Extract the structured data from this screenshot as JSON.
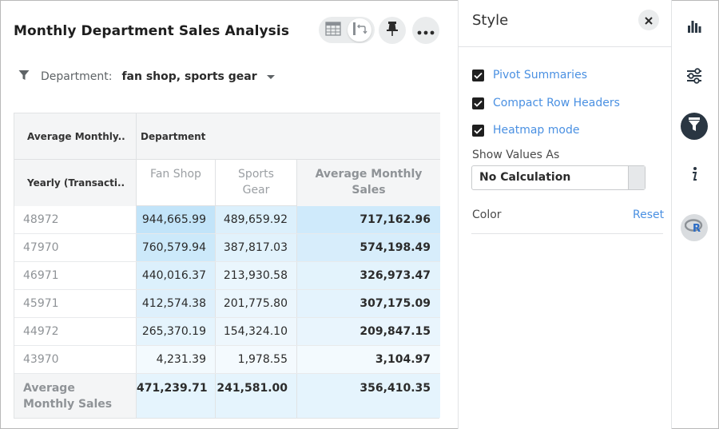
{
  "header": {
    "title": "Monthly Department Sales Analysis"
  },
  "filter": {
    "label": "Department:",
    "value": "fan shop, sports gear"
  },
  "table": {
    "corner_header": "Average Monthly..",
    "column_group_header": "Department",
    "row_header": "Yearly (Transacti..",
    "columns": [
      "Fan Shop",
      "Sports Gear",
      "Average Monthly Sales"
    ],
    "rows": [
      {
        "key": "48972",
        "fan_shop": "944,665.99",
        "sports_gear": "489,659.92",
        "average": "717,162.96",
        "heat": [
          0.95,
          0.45
        ]
      },
      {
        "key": "47970",
        "fan_shop": "760,579.94",
        "sports_gear": "387,817.03",
        "average": "574,198.49",
        "heat": [
          0.75,
          0.35
        ]
      },
      {
        "key": "46971",
        "fan_shop": "440,016.37",
        "sports_gear": "213,930.58",
        "average": "326,973.47",
        "heat": [
          0.45,
          0.18
        ]
      },
      {
        "key": "45971",
        "fan_shop": "412,574.38",
        "sports_gear": "201,775.80",
        "average": "307,175.09",
        "heat": [
          0.42,
          0.17
        ]
      },
      {
        "key": "44972",
        "fan_shop": "265,370.19",
        "sports_gear": "154,324.10",
        "average": "209,847.15",
        "heat": [
          0.28,
          0.12
        ]
      },
      {
        "key": "43970",
        "fan_shop": "4,231.39",
        "sports_gear": "1,978.55",
        "average": "3,104.97",
        "heat": [
          0.02,
          0.0
        ]
      }
    ],
    "total": {
      "label": "Average Monthly Sales",
      "fan_shop": "471,239.71",
      "sports_gear": "241,581.00",
      "average": "356,410.35"
    }
  },
  "style_panel": {
    "title": "Style",
    "options": [
      {
        "label": "Pivot Summaries",
        "checked": true
      },
      {
        "label": "Compact Row Headers",
        "checked": true
      },
      {
        "label": "Heatmap mode",
        "checked": true
      }
    ],
    "show_values_label": "Show Values As",
    "show_values_selected": "No Calculation",
    "color_label": "Color",
    "reset_label": "Reset"
  },
  "colors": {
    "accent": "#4a90e2",
    "heat_low": "#f4fafe",
    "heat_high": "#bfe3f9",
    "rail_active": "#2a3642"
  },
  "icons": {
    "view_table": "table-icon",
    "view_chart": "chart-config-icon",
    "pin": "pin-icon",
    "more": "more-icon",
    "filter": "filter-icon",
    "close": "close-icon",
    "rail": [
      "bar-chart-icon",
      "settings-sliders-icon",
      "funnel-icon",
      "info-icon",
      "r-script-icon"
    ]
  }
}
